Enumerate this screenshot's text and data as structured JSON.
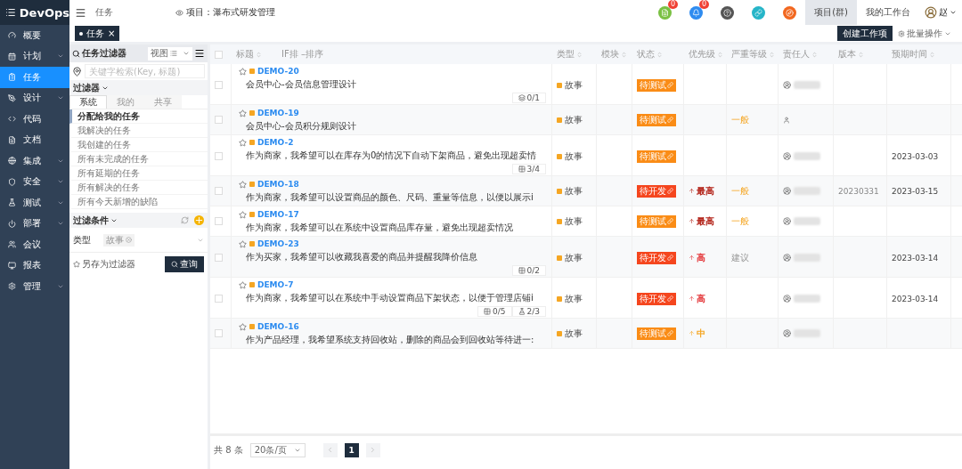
{
  "brand": "DevOps",
  "sidebar": {
    "items": [
      {
        "label": "概要",
        "expandable": false,
        "selected": false
      },
      {
        "label": "计划",
        "expandable": true,
        "selected": false
      },
      {
        "label": "任务",
        "expandable": false,
        "selected": true
      },
      {
        "label": "设计",
        "expandable": true,
        "selected": false
      },
      {
        "label": "代码",
        "expandable": false,
        "selected": false
      },
      {
        "label": "文档",
        "expandable": false,
        "selected": false
      },
      {
        "label": "集成",
        "expandable": true,
        "selected": false
      },
      {
        "label": "安全",
        "expandable": true,
        "selected": false
      },
      {
        "label": "测试",
        "expandable": true,
        "selected": false
      },
      {
        "label": "部署",
        "expandable": true,
        "selected": false
      },
      {
        "label": "会议",
        "expandable": false,
        "selected": false
      },
      {
        "label": "报表",
        "expandable": false,
        "selected": false
      },
      {
        "label": "管理",
        "expandable": true,
        "selected": false
      }
    ]
  },
  "header": {
    "breadcrumb": "任务",
    "project": "项目：瀑布式研发管理",
    "notifications": [
      {
        "kind": "doc",
        "count": "0",
        "color": "#7ac143"
      },
      {
        "kind": "bell",
        "count": "0",
        "color": "#2f8cf0"
      },
      {
        "kind": "help",
        "color": "#555555"
      },
      {
        "kind": "link",
        "color": "#26b5c8"
      },
      {
        "kind": "compass",
        "color": "#f2671f"
      }
    ],
    "nav": [
      {
        "label": "项目(群)",
        "selected": true
      },
      {
        "label": "我的工作台",
        "selected": false
      }
    ],
    "user": "赵"
  },
  "open_tabs": [
    {
      "label": "任务",
      "close": "×"
    }
  ],
  "actions": {
    "create": "创建工作项",
    "batch": "批量操作"
  },
  "filter_panel": {
    "title": "任务过滤器",
    "view_select": "视图",
    "search_placeholder": "关键字检索(Key, 标题)",
    "filters_title": "过滤器",
    "tabs": [
      {
        "label": "系统",
        "selected": true
      },
      {
        "label": "我的",
        "selected": false
      },
      {
        "label": "共享",
        "selected": false
      }
    ],
    "items": [
      {
        "label": "分配给我的任务",
        "selected": true
      },
      {
        "label": "我解决的任务",
        "selected": false
      },
      {
        "label": "我创建的任务",
        "selected": false
      },
      {
        "label": "所有未完成的任务",
        "selected": false
      },
      {
        "label": "所有延期的任务",
        "selected": false
      },
      {
        "label": "所有解决的任务",
        "selected": false
      },
      {
        "label": "所有今天新增的缺陷",
        "selected": false
      }
    ],
    "conditions_title": "过滤条件",
    "condition": {
      "label": "类型",
      "tag": "故事"
    },
    "save_link": "另存为过滤器",
    "query_button": "查询"
  },
  "table": {
    "select_all": false,
    "columns": [
      "标题",
      "IF排 –排序",
      "类型",
      "模块",
      "状态",
      "优先级",
      "严重等级",
      "责任人",
      "版本",
      "预期时间"
    ],
    "rows": [
      {
        "checked": false,
        "key": "DEMO-20",
        "title": "会员中心-会员信息管理设计",
        "badges": [
          {
            "kind": "layers",
            "text": "0/1"
          }
        ],
        "type": "故事",
        "status": {
          "text": "待测试",
          "kind": "testing"
        },
        "assignee": {
          "kind": "avatar"
        }
      },
      {
        "checked": false,
        "key": "DEMO-19",
        "title": "会员中心-会员积分规则设计",
        "badges": [],
        "type": "故事",
        "status": {
          "text": "待测试",
          "kind": "testing"
        },
        "severity": {
          "text": "一般",
          "kind": "normal"
        },
        "assignee": {
          "kind": "person"
        }
      },
      {
        "checked": false,
        "key": "DEMO-2",
        "title": "作为商家，我希望可以在库存为0的情况下自动下架商品，避免出现超卖情",
        "badges": [
          {
            "kind": "grid",
            "text": "3/4"
          }
        ],
        "type": "故事",
        "status": {
          "text": "待测试",
          "kind": "testing"
        },
        "assignee": {
          "kind": "avatar"
        },
        "due": "2023-03-03"
      },
      {
        "checked": false,
        "key": "DEMO-18",
        "title": "作为商家，我希望可以设置商品的颜色、尺码、重量等信息，以便以展示i",
        "badges": [],
        "type": "故事",
        "status": {
          "text": "待开发",
          "kind": "todo"
        },
        "priority": {
          "text": "最高",
          "kind": "highest"
        },
        "severity": {
          "text": "一般",
          "kind": "normal"
        },
        "assignee": {
          "kind": "avatar"
        },
        "version": "20230331",
        "due": "2023-03-15"
      },
      {
        "checked": false,
        "key": "DEMO-17",
        "title": "作为商家，我希望可以在系统中设置商品库存量，避免出现超卖情况",
        "badges": [],
        "type": "故事",
        "status": {
          "text": "待测试",
          "kind": "testing"
        },
        "priority": {
          "text": "最高",
          "kind": "highest"
        },
        "severity": {
          "text": "一般",
          "kind": "normal"
        },
        "assignee": {
          "kind": "avatar"
        }
      },
      {
        "checked": false,
        "key": "DEMO-23",
        "title": "作为买家，我希望可以收藏我喜爱的商品并提醒我降价信息",
        "badges": [
          {
            "kind": "grid",
            "text": "0/2"
          }
        ],
        "type": "故事",
        "status": {
          "text": "待开发",
          "kind": "todo"
        },
        "priority": {
          "text": "高",
          "kind": "high"
        },
        "severity": {
          "text": "建议",
          "kind": "suggest"
        },
        "assignee": {
          "kind": "avatar"
        },
        "due": "2023-03-14"
      },
      {
        "checked": false,
        "key": "DEMO-7",
        "title": "作为商家，我希望可以在系统中手动设置商品下架状态，以便于管理店铺i",
        "badges": [
          {
            "kind": "grid",
            "text": "0/5"
          },
          {
            "kind": "flask",
            "text": "2/3"
          }
        ],
        "type": "故事",
        "status": {
          "text": "待开发",
          "kind": "todo"
        },
        "priority": {
          "text": "高",
          "kind": "high"
        },
        "assignee": {
          "kind": "avatar"
        },
        "due": "2023-03-14"
      },
      {
        "checked": false,
        "key": "DEMO-16",
        "title": "作为产品经理，我希望系统支持回收站，删除的商品会到回收站等待进一:",
        "badges": [],
        "type": "故事",
        "status": {
          "text": "待测试",
          "kind": "testing"
        },
        "priority": {
          "text": "中",
          "kind": "medium"
        },
        "assignee": {
          "kind": "avatar"
        }
      }
    ]
  },
  "pagination": {
    "total": "共 8 条",
    "page_size": "20条/页",
    "pages": [
      {
        "label": "1",
        "selected": true
      }
    ]
  }
}
